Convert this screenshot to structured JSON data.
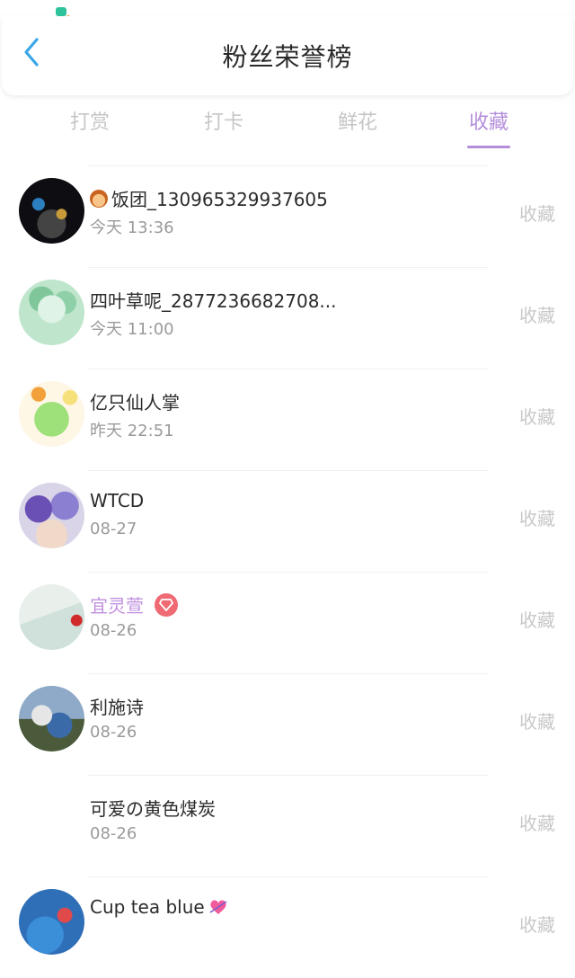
{
  "header": {
    "title": "粉丝荣誉榜"
  },
  "tabs": [
    {
      "label": "打赏",
      "active": false
    },
    {
      "label": "打卡",
      "active": false
    },
    {
      "label": "鲜花",
      "active": false
    },
    {
      "label": "收藏",
      "active": true
    }
  ],
  "colors": {
    "accent": "#b48edb",
    "vip_name": "#c08fe0",
    "badge": "#f06a74"
  },
  "fans": [
    {
      "name": "饭团_130965329937605",
      "time": "今天 13:36",
      "action": "收藏",
      "prefix_icon": "monkey-emoji"
    },
    {
      "name": "四叶草呢_2877236682708...",
      "time": "今天 11:00",
      "action": "收藏"
    },
    {
      "name": "亿只仙人掌",
      "time": "昨天 22:51",
      "action": "收藏"
    },
    {
      "name": "WTCD",
      "time": "08-27",
      "action": "收藏"
    },
    {
      "name": "宜灵萱",
      "time": "08-26",
      "action": "收藏",
      "vip": true,
      "badge_icon": "diamond-badge-icon"
    },
    {
      "name": "利施诗",
      "time": "08-26",
      "action": "收藏"
    },
    {
      "name": "可爱の黄色煤炭",
      "time": "08-26",
      "action": "收藏"
    },
    {
      "name": "Cup tea blue",
      "time": "",
      "action": "收藏",
      "suffix_icon": "heart-emoji"
    }
  ]
}
